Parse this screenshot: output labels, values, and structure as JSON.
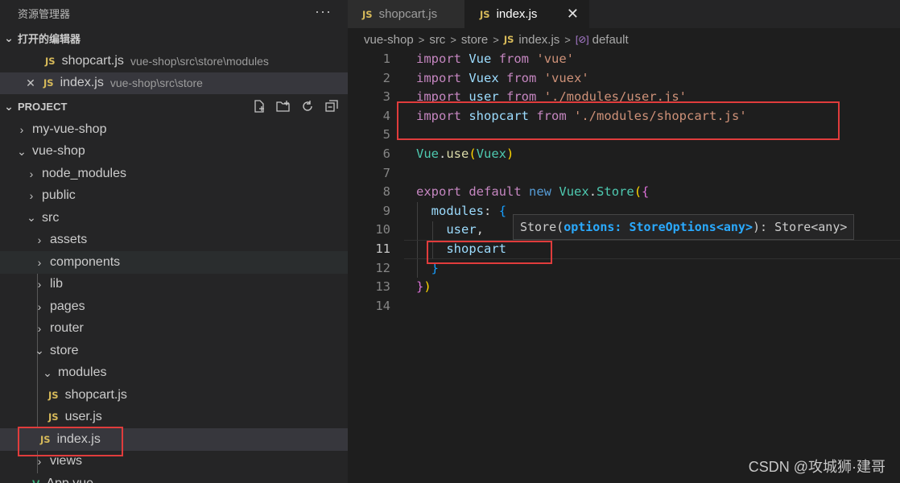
{
  "sidebar": {
    "title": "资源管理器",
    "more_icon": "ellipsis-icon",
    "open_editors": {
      "label": "打开的编辑器",
      "items": [
        {
          "name": "shopcart.js",
          "path": "vue-shop\\src\\store\\modules",
          "icon": "js"
        },
        {
          "name": "index.js",
          "path": "vue-shop\\src\\store",
          "icon": "js"
        }
      ]
    },
    "project": {
      "label": "PROJECT",
      "actions": [
        "new-file-icon",
        "new-folder-icon",
        "refresh-icon",
        "collapse-all-icon"
      ],
      "tree": [
        {
          "label": "my-vue-shop"
        },
        {
          "label": "vue-shop"
        },
        {
          "label": "node_modules"
        },
        {
          "label": "public"
        },
        {
          "label": "src"
        },
        {
          "label": "assets"
        },
        {
          "label": "components"
        },
        {
          "label": "lib"
        },
        {
          "label": "pages"
        },
        {
          "label": "router"
        },
        {
          "label": "store"
        },
        {
          "label": "modules"
        },
        {
          "label": "shopcart.js"
        },
        {
          "label": "user.js"
        },
        {
          "label": "index.js"
        },
        {
          "label": "views"
        },
        {
          "label": "App.vue"
        }
      ]
    }
  },
  "editor": {
    "tabs": [
      {
        "label": "shopcart.js",
        "active": false
      },
      {
        "label": "index.js",
        "active": true
      }
    ],
    "tab_badge": "JS",
    "breadcrumb": {
      "items": [
        "vue-shop",
        "src",
        "store",
        "index.js",
        "default"
      ],
      "separator": ">"
    },
    "line_numbers": [
      "1",
      "2",
      "3",
      "4",
      "5",
      "6",
      "7",
      "8",
      "9",
      "10",
      "11",
      "12",
      "13",
      "14"
    ],
    "current_line": 11,
    "tooltip": {
      "prefix": "Store(",
      "param": "options: StoreOptions<any>",
      "suffix": "): Store<any>"
    }
  },
  "watermark": "CSDN @攻城狮·建哥",
  "colors": {
    "highlight_box": "#e03c3c",
    "js_badge": "#d7ba5a",
    "keyword": "#c586c0",
    "string": "#ce9178"
  }
}
